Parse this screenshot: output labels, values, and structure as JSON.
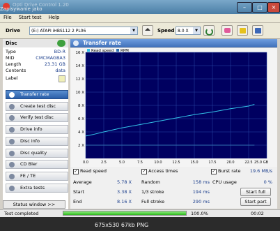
{
  "window": {
    "title": "Opti Drive Control 1.20",
    "overlay_text": "Zapisywanie jako"
  },
  "menu": [
    "File",
    "Start test",
    "Help"
  ],
  "toolbar": {
    "drive_label": "Drive",
    "drive_value": "(E:)  ATAPI iHBS112   2 PL06",
    "speed_label": "Speed",
    "speed_value": "8.0 X"
  },
  "disc": {
    "header": "Disc",
    "rows": [
      {
        "key": "Type",
        "value": "BD-R"
      },
      {
        "key": "MID",
        "value": "CMCMAGBA3"
      },
      {
        "key": "Length",
        "value": "23.31 GB"
      },
      {
        "key": "Contents",
        "value": "data"
      },
      {
        "key": "Label",
        "value": ""
      }
    ]
  },
  "nav": [
    {
      "label": "Transfer rate",
      "active": true
    },
    {
      "label": "Create test disc"
    },
    {
      "label": "Verify test disc"
    },
    {
      "label": "Drive info"
    },
    {
      "label": "Disc info"
    },
    {
      "label": "Disc quality"
    },
    {
      "label": "CD Bler"
    },
    {
      "label": "FE / TE"
    },
    {
      "label": "Extra tests"
    }
  ],
  "status_window_label": "Status window >>",
  "panel_title": "Transfer rate",
  "chart_data": {
    "type": "line",
    "legend": [
      "Read speed",
      "RPM"
    ],
    "ylim": [
      0,
      16
    ],
    "xlim": [
      0,
      25
    ],
    "y_ticks": [
      "16 X",
      "14 X",
      "12 X",
      "10 X",
      "8 X",
      "6 X",
      "4 X",
      "2 X"
    ],
    "x_ticks": [
      "0.0",
      "2.5",
      "5.0",
      "7.5",
      "10.0",
      "12.5",
      "15.0",
      "17.5",
      "20.0",
      "22.5",
      "25.0 GB"
    ],
    "series": [
      {
        "name": "Read speed",
        "color": "#33c3e8",
        "x": [
          0,
          1,
          2.5,
          5,
          7.5,
          10,
          12.5,
          15,
          17.5,
          20,
          22.5,
          23.3
        ],
        "y": [
          3.38,
          3.6,
          4.0,
          4.6,
          5.1,
          5.6,
          6.1,
          6.6,
          7.0,
          7.5,
          7.9,
          8.16
        ]
      },
      {
        "name": "RPM",
        "color": "#2f6fb0",
        "x": [
          0,
          23.3
        ],
        "y": [
          2.0,
          2.0
        ]
      }
    ],
    "background": "#000060",
    "grid_color": "#2b4aa6"
  },
  "stats": {
    "read_speed_label": "Read speed",
    "access_times_label": "Access times",
    "burst_rate_label": "Burst rate",
    "burst_rate_value": "19.6 MB/s",
    "average_label": "Average",
    "average_value": "5.78 X",
    "start_label": "Start",
    "start_value": "3.38 X",
    "end_label": "End",
    "end_value": "8.16 X",
    "random_label": "Random",
    "random_value": "158 ms",
    "third_stroke_label": "1/3 stroke",
    "third_stroke_value": "194 ms",
    "full_stroke_label": "Full stroke",
    "full_stroke_value": "290 ms",
    "cpu_usage_label": "CPU usage",
    "cpu_usage_value": "0 %",
    "start_full_label": "Start full",
    "start_part_label": "Start part"
  },
  "statusbar": {
    "text": "Test completed",
    "progress_fraction": 1.0,
    "progress_text": "100.0%",
    "time": "00:02"
  },
  "footer": {
    "text": "675x530  67kb  PNG"
  }
}
